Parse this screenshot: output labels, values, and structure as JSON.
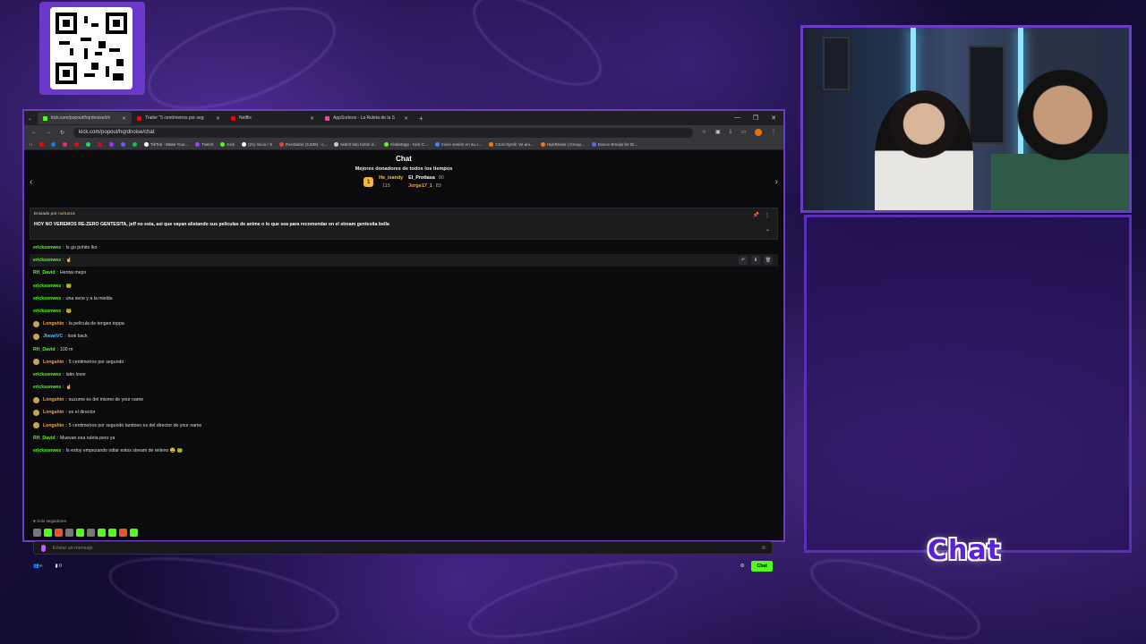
{
  "browser": {
    "tabs": [
      {
        "label": "kick.com/popout/hqrdnoise/ch",
        "color": "#53fc18",
        "active": true
      },
      {
        "label": "Trailer \"5 centímetros por seg",
        "color": "#ff0000",
        "active": false
      },
      {
        "label": "Netflix",
        "color": "#e50914",
        "active": false
      },
      {
        "label": "AppSorteos - La Ruleta de la S",
        "color": "#e44ba0",
        "active": false
      }
    ],
    "url": "kick.com/popout/hqrdnoise/chat",
    "bookmarks": [
      {
        "label": "TikTok - Make Your...",
        "color": "#fff"
      },
      {
        "label": "Twitch",
        "color": "#9146ff"
      },
      {
        "label": "Kick",
        "color": "#53fc18"
      },
      {
        "label": "(21) Inicio / X",
        "color": "#fff"
      },
      {
        "label": "Recibidos (3,639) - c...",
        "color": "#ea4335"
      },
      {
        "label": "twitch bito botón d...",
        "color": "#ccc"
      },
      {
        "label": "Kiddetapp - Kick C...",
        "color": "#53fc18"
      },
      {
        "label": "Inicie sesión en su c...",
        "color": "#4285f4"
      },
      {
        "label": "Crunchyroll: Ve ani...",
        "color": "#f47521"
      },
      {
        "label": "HqrdNoise | Group...",
        "color": "#f47521"
      },
      {
        "label": "Dance Emojis for Di...",
        "color": "#5865f2"
      }
    ]
  },
  "kick": {
    "title": "Chat",
    "donors_title": "Mejores donadores de todos los tiempos",
    "donors": [
      {
        "name": "He_isandy",
        "value": "115"
      },
      {
        "name": "El_Prottasa",
        "value": "90"
      },
      {
        "name": "Jorge17_1",
        "value": "83"
      }
    ],
    "medal": "1",
    "pinned": {
      "label": "Enviado por",
      "by": "nortus18",
      "message": "HOY NO VEREMOS RE-ZERO GENTESITA, jeff no esta, asi que vayan alistando sus peliculas de anime o lo que sea para recomendar en el stream gentesita bella"
    },
    "messages": [
      {
        "user": "ericksonwes",
        "color": "#53fc18",
        "text": "Is go pohito lko",
        "badge": false
      },
      {
        "user": "ericksonwes",
        "color": "#53fc18",
        "text": "☝",
        "badge": false,
        "highlight": true
      },
      {
        "user": "RH_David",
        "color": "#53fc18",
        "text": "Hentai mejor",
        "badge": false
      },
      {
        "user": "ericksonwes",
        "color": "#53fc18",
        "text": "🐸",
        "badge": false
      },
      {
        "user": "ericksonwes",
        "color": "#53fc18",
        "text": "una serie y a la mielda",
        "badge": false
      },
      {
        "user": "ericksonwes",
        "color": "#53fc18",
        "text": "🐸",
        "badge": false
      },
      {
        "user": "Longshin",
        "color": "#f5a742",
        "text": "la pelicula de tengen toppa",
        "badge": true
      },
      {
        "user": "JheanVC",
        "color": "#4fc3f7",
        "text": "look back",
        "badge": true
      },
      {
        "user": "RH_David",
        "color": "#53fc18",
        "text": "100 m",
        "badge": false
      },
      {
        "user": "Longshin",
        "color": "#f5a742",
        "text": "5 centimetros por segundo",
        "badge": true
      },
      {
        "user": "ericksonwes",
        "color": "#53fc18",
        "text": "latin lover",
        "badge": false
      },
      {
        "user": "ericksonwes",
        "color": "#53fc18",
        "text": "☝",
        "badge": false
      },
      {
        "user": "Longshin",
        "color": "#f5a742",
        "text": "suzume es del mismo de your name",
        "badge": true
      },
      {
        "user": "Longshin",
        "color": "#f5a742",
        "text": "es el director",
        "badge": true
      },
      {
        "user": "Longshin",
        "color": "#f5a742",
        "text": "5 centimetros por segundo tambien es del director de your name",
        "badge": true
      },
      {
        "user": "RH_David",
        "color": "#53fc18",
        "text": "Muevan esa ruleta pero ya",
        "badge": false
      },
      {
        "user": "ericksonwes",
        "color": "#53fc18",
        "text": "Is estoy empezando odiar estos stream de relleno 😩 🐸",
        "badge": false
      }
    ],
    "followers_only": "♥ Solo seguidores",
    "input_placeholder": "Enviar un mensaje",
    "bottom_count": "0",
    "chat_button": "Chat"
  },
  "overlay": {
    "chat_label": "Chat"
  }
}
